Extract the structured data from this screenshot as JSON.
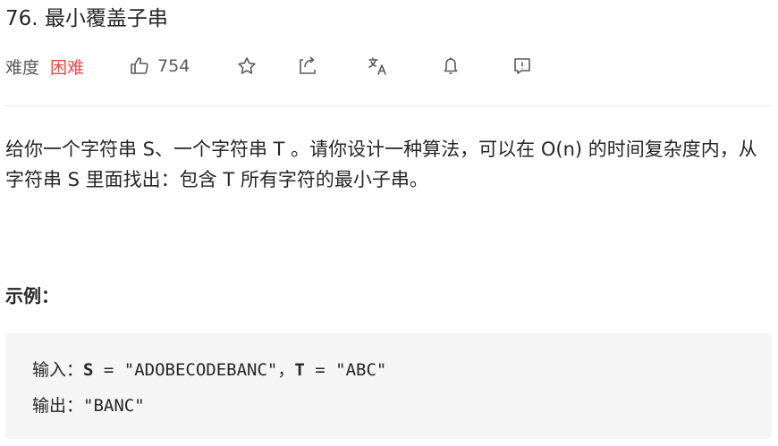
{
  "problem": {
    "title": "76. 最小覆盖子串",
    "difficulty_label": "难度",
    "difficulty": "困难",
    "likes": "754"
  },
  "toolbar": {
    "icons": [
      "thumbs-up-icon",
      "star-icon",
      "share-icon",
      "translate-icon",
      "bell-icon",
      "feedback-icon"
    ]
  },
  "description": "给你一个字符串 S、一个字符串 T 。请你设计一种算法，可以在 O(n) 的时间复杂度内，从字符串 S 里面找出：包含 T 所有字符的最小子串。",
  "example": {
    "heading": "示例：",
    "input_label": "输入：",
    "s_name": "S",
    "s_value": " = \"ADOBECODEBANC\"",
    "separator": "，",
    "t_name": "T",
    "t_value": " = \"ABC\"",
    "output_label": "输出：",
    "output_value": "\"BANC\""
  },
  "colors": {
    "difficulty_hard": "#ef4743",
    "code_bg": "#f5f5f5"
  }
}
